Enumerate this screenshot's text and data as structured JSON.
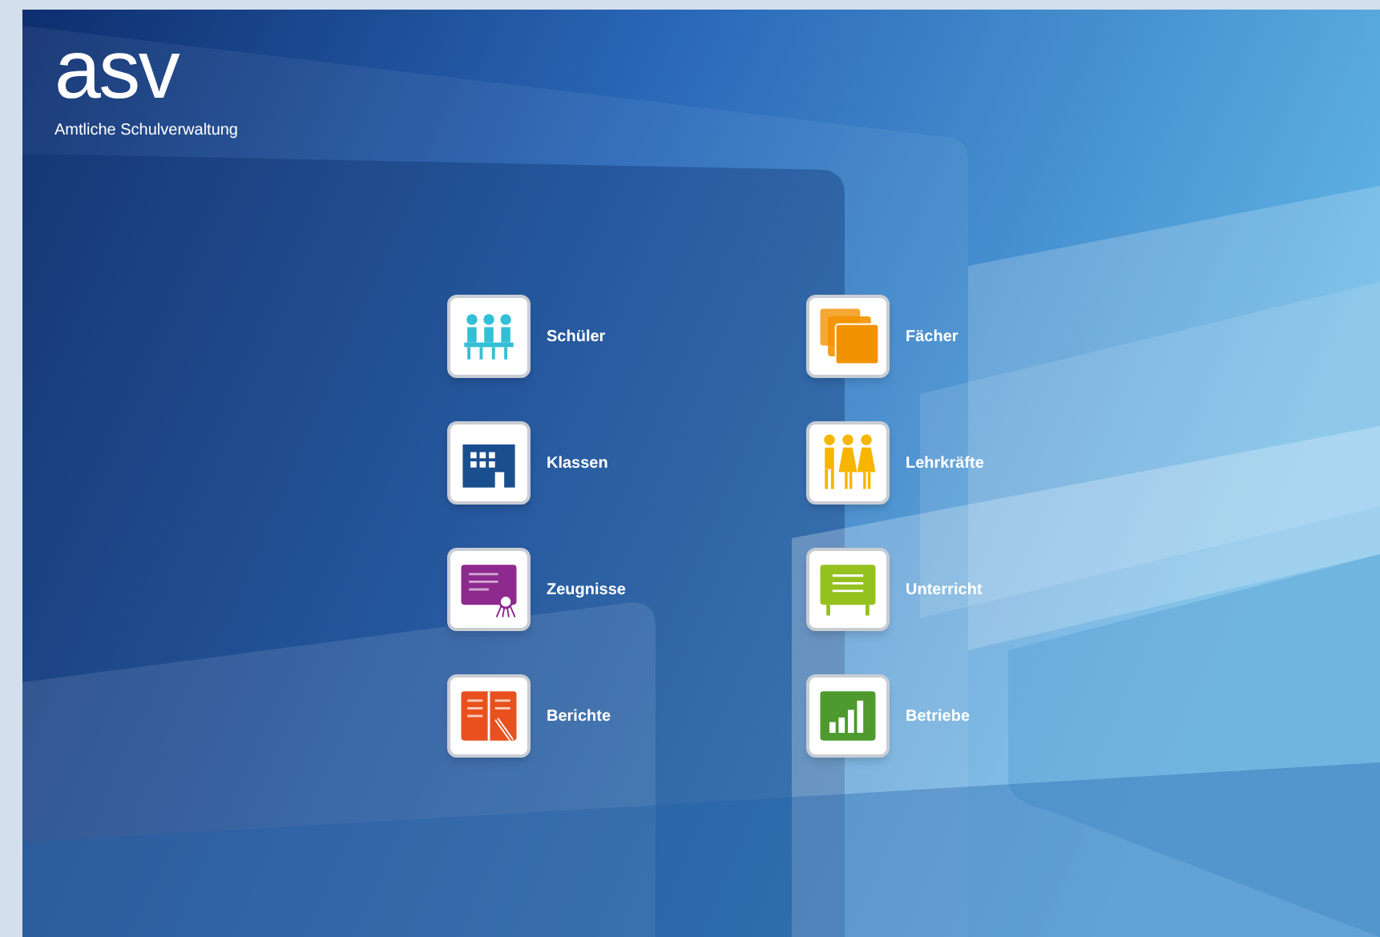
{
  "logo": {
    "wordmark": "asv",
    "subtitle": "Amtliche Schulverwaltung"
  },
  "modules": [
    {
      "label": "Schüler",
      "kind": "pupils",
      "color": "#33bfd6"
    },
    {
      "label": "Fächer",
      "kind": "folders",
      "color": "#f39200"
    },
    {
      "label": "Klassen",
      "kind": "building",
      "color": "#1a4f8f"
    },
    {
      "label": "Lehrkräfte",
      "kind": "teachers",
      "color": "#f7b500"
    },
    {
      "label": "Zeugnisse",
      "kind": "certificate",
      "color": "#8e2a8f"
    },
    {
      "label": "Unterricht",
      "kind": "board",
      "color": "#95c11f"
    },
    {
      "label": "Berichte",
      "kind": "book",
      "color": "#e8501e"
    },
    {
      "label": "Betriebe",
      "kind": "chart",
      "color": "#4e9a2e"
    }
  ]
}
